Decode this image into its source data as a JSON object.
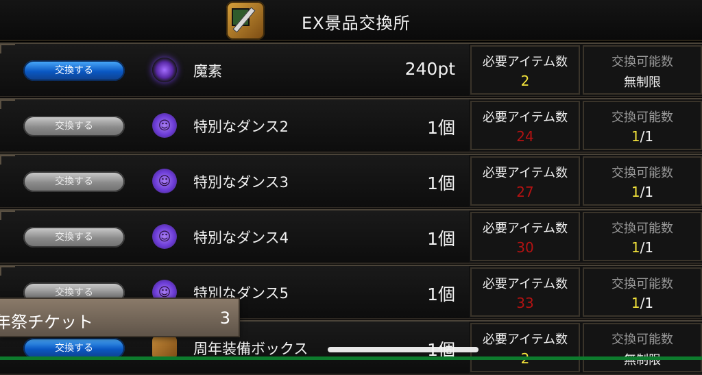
{
  "header": {
    "title": "EX景品交換所",
    "icon": "treasure-chest-sword-icon"
  },
  "columns": {
    "required": "必要アイテム数",
    "possible": "交換可能数"
  },
  "rows": [
    {
      "button": "交換する",
      "button_state": "active",
      "icon": "dark-orb-icon",
      "name": "魔素",
      "amount": "240pt",
      "required": "2",
      "required_color": "#f3e33b",
      "possible_text": "無制限",
      "possible_current": "",
      "possible_sep": "",
      "possible_total": ""
    },
    {
      "button": "交換する",
      "button_state": "disabled",
      "icon": "dance-figure-icon",
      "name": "特別なダンス2",
      "amount": "1個",
      "required": "24",
      "required_color": "#b41212",
      "possible_text": "",
      "possible_current": "1",
      "possible_sep": "/",
      "possible_total": "1"
    },
    {
      "button": "交換する",
      "button_state": "disabled",
      "icon": "dance-figure-icon",
      "name": "特別なダンス3",
      "amount": "1個",
      "required": "27",
      "required_color": "#b41212",
      "possible_text": "",
      "possible_current": "1",
      "possible_sep": "/",
      "possible_total": "1"
    },
    {
      "button": "交換する",
      "button_state": "disabled",
      "icon": "dance-figure-icon",
      "name": "特別なダンス4",
      "amount": "1個",
      "required": "30",
      "required_color": "#b41212",
      "possible_text": "",
      "possible_current": "1",
      "possible_sep": "/",
      "possible_total": "1"
    },
    {
      "button": "交換する",
      "button_state": "disabled",
      "icon": "dance-figure-icon",
      "name": "特別なダンス5",
      "amount": "1個",
      "required": "33",
      "required_color": "#b41212",
      "possible_text": "",
      "possible_current": "1",
      "possible_sep": "/",
      "possible_total": "1"
    },
    {
      "button": "交換する",
      "button_state": "active",
      "icon": "equipment-box-icon",
      "name": "周年装備ボックス",
      "amount": "1個",
      "required": "2",
      "required_color": "#f3e33b",
      "possible_text": "無制限",
      "possible_current": "",
      "possible_sep": "",
      "possible_total": ""
    }
  ],
  "popup": {
    "label": "年祭チケット",
    "count": "3"
  }
}
